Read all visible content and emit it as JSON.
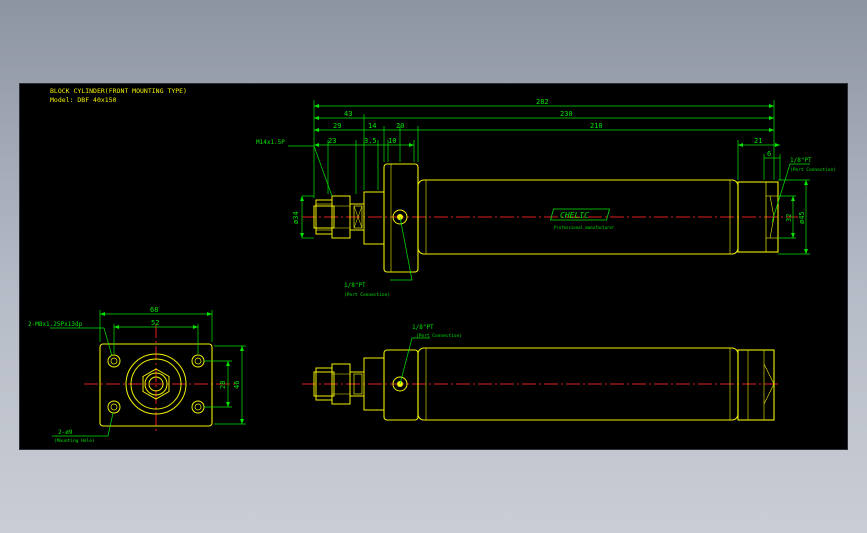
{
  "header": {
    "title": "BLOCK CYLINDER(FRONT MOUNTING TYPE)",
    "model": "Model: DBF 40x150"
  },
  "dimensions": {
    "overall": "282",
    "d43": "43",
    "d230": "230",
    "d29": "29",
    "d14": "14",
    "d20": "20",
    "d210": "210",
    "d23": "23",
    "d35": "3.5",
    "d10": "10",
    "d21": "21",
    "d6": "6",
    "phi34": "ø34",
    "d32": "32",
    "phi45": "ø45",
    "d68": "68",
    "d52": "52",
    "d28": "28",
    "d46": "46"
  },
  "callouts": {
    "rod_thread": "M14x1.5P",
    "port_top": "1/8\"PT",
    "port_top_sub": "(Port Connection)",
    "port_mid": "1/8\"PT",
    "port_mid_sub": "(Port Connection)",
    "port_bottom": "1/8\"PT",
    "port_bottom_sub": "(Port Connection)",
    "tap_holes": "2-M8x1.25Px13dp",
    "mount_holes": "2-ø9",
    "mount_holes_sub": "(Mounting Hole)"
  },
  "logo": {
    "brand": "CHELIC",
    "tagline": "Professional manufacturer"
  },
  "colors": {
    "canvas": "#000000",
    "outline": "#f0f000",
    "dimension": "#00e400",
    "centerline": "#e02020",
    "text": "#00d8d8"
  }
}
